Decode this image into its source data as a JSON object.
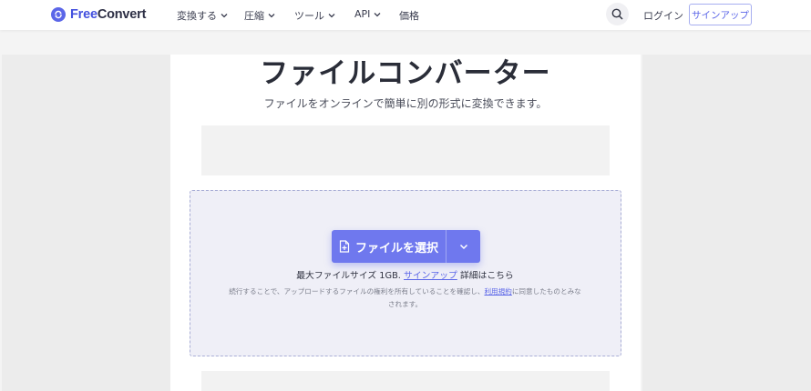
{
  "header": {
    "logo": {
      "part1": "Free",
      "part2": "Convert"
    },
    "nav": [
      {
        "label": "変換する"
      },
      {
        "label": "圧縮"
      },
      {
        "label": "ツール"
      },
      {
        "label": "API"
      },
      {
        "label": "価格"
      }
    ],
    "login_label": "ログイン",
    "signup_label": "サインアップ",
    "search_icon": "search-icon"
  },
  "hero": {
    "title": "ファイルコンバーター",
    "subtitle": "ファイルをオンラインで簡単に別の形式に変換できます。"
  },
  "uploader": {
    "choose_label": "ファイルを選択",
    "max_prefix": "最大ファイルサイズ 1GB.",
    "max_link": "サインアップ",
    "max_suffix": " 詳細はこちら",
    "terms_prefix": "続行することで、アップロードするファイルの権利を所有していることを確認し、",
    "terms_link": "利用規約",
    "terms_suffix": "に同意したものとみなされます。"
  },
  "colors": {
    "brand": "#5b66e8",
    "button": "#6f78ee",
    "dropzone_bg": "#efeff7"
  }
}
